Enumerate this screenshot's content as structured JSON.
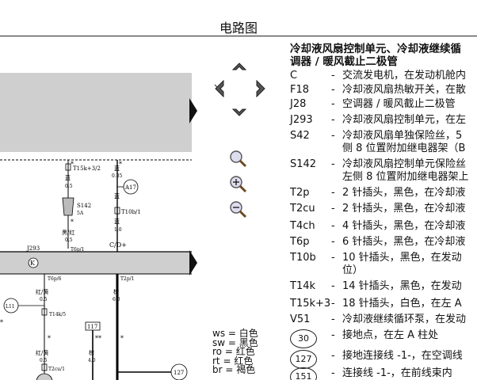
{
  "page": {
    "title": "电路图"
  },
  "legend": {
    "heading_line1": "冷却液风扇控制单元、冷却液继续循",
    "heading_line2": "调器 / 暖风截止二极管",
    "items": [
      {
        "code": "C",
        "desc": "交流发电机，在发动机舱内"
      },
      {
        "code": "F18",
        "desc": "冷却液风扇热敏开关，在散"
      },
      {
        "code": "J28",
        "desc": "空调器 / 暖风截止二极管"
      },
      {
        "code": "J293",
        "desc": "冷却液风扇控制单元，在左"
      },
      {
        "code": "S42",
        "desc": "冷却液风扇单独保险丝，5",
        "desc2": "侧 8 位置附加继电器架（B"
      },
      {
        "code": "S142",
        "desc": "冷却液风扇控制单元保险丝",
        "desc2": "左侧 8 位置附加继电器架上"
      },
      {
        "code": "T2p",
        "desc": "2 针插头，黑色，在冷却液"
      },
      {
        "code": "T2cu",
        "desc": "2 针插头，黑色，在冷却液"
      },
      {
        "code": "T4ch",
        "desc": "4 针插头，黑色，在冷却液"
      },
      {
        "code": "T6p",
        "desc": "6 针插头，黑色，在冷却液"
      },
      {
        "code": "T10b",
        "desc": "10 针插头，黑色，在发动",
        "desc2": "位）"
      },
      {
        "code": "T14k",
        "desc": "14 针插头，黑色，在发动"
      },
      {
        "code": "T15k+3",
        "desc": "18 针插头，白色，在左 A"
      },
      {
        "code": "V51",
        "desc": "冷却液继续循环泵，在发动"
      },
      {
        "code": "30",
        "desc": "接地点，在左 A 柱处"
      },
      {
        "code": "127",
        "desc": "接地连接线 -1-，在空调线"
      },
      {
        "code": "151",
        "desc": "连接线 -1-，在前线束内"
      }
    ]
  },
  "wire_colors": [
    {
      "abbr": "ws",
      "name": "白色"
    },
    {
      "abbr": "sw",
      "name": "黑色"
    },
    {
      "abbr": "ro",
      "name": "红色"
    },
    {
      "abbr": "rt",
      "name": "红色"
    },
    {
      "abbr": "br",
      "name": "褐色"
    }
  ],
  "diagram": {
    "labels": {
      "t15k": "T15k+3/2",
      "blue1": "蓝",
      "w035": "0.35",
      "blue2": "蓝",
      "w05a": "0.5",
      "s142": "S142",
      "s142_amp": "5A",
      "t10b": "T10b/1",
      "blue3": "蓝",
      "w10": "1.0",
      "a17": "A17",
      "black_red": "黑/红",
      "w05b": "0.5",
      "t6p1": "T6p/1",
      "cd": "C/D+",
      "j293": "J293",
      "k": "K",
      "t6p6": "T6p/6",
      "red_yellow1": "红/黄",
      "w05c": "0.5",
      "t14k5": "T14k/5",
      "l11": "L11",
      "t2p1": "T2p/1",
      "brown": "棕",
      "w60": "6.0",
      "n117": "117",
      "red_yellow2": "红/黄",
      "w05d": "0.5",
      "black": "棕",
      "w40": "4.0",
      "t2cu": "T2cu/1",
      "n127": "127",
      "star": "*",
      "dstar": "**"
    }
  }
}
